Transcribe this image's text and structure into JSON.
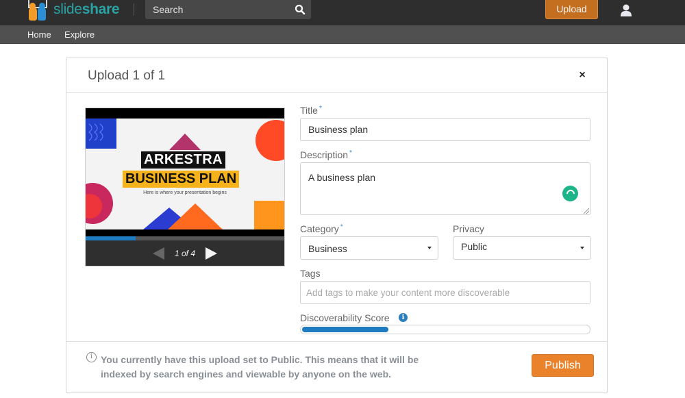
{
  "header": {
    "logo_text_light": "slide",
    "logo_text_bold": "share",
    "search_placeholder": "Search",
    "upload_label": "Upload",
    "icons": {
      "search": "search-icon",
      "user": "user-icon"
    }
  },
  "nav": {
    "items": [
      {
        "label": "Home"
      },
      {
        "label": "Explore"
      }
    ]
  },
  "modal": {
    "title": "Upload 1 of 1",
    "close_label": "×",
    "preview": {
      "slide_title_line1": "ARKESTRA",
      "slide_title_line2": "BUSINESS PLAN",
      "slide_subtitle": "Here is where your presentation begins",
      "current_page": 1,
      "total_pages": 4,
      "page_indicator": "1 of 4",
      "progress_fraction": 0.25
    },
    "form": {
      "title_label": "Title",
      "title_value": "Business plan",
      "description_label": "Description",
      "description_value": "A business plan",
      "category_label": "Category",
      "category_value": "Business",
      "privacy_label": "Privacy",
      "privacy_value": "Public",
      "tags_label": "Tags",
      "tags_placeholder": "Add tags to make your content more discoverable",
      "tags_value": "",
      "score_label": "Discoverability Score",
      "score_fraction": 0.3,
      "required_marker": "*"
    },
    "footer": {
      "notice": "You currently have this upload set to Public. This means that it will be indexed by search engines and viewable by anyone on the web.",
      "publish_label": "Publish"
    }
  },
  "colors": {
    "topbar": "#2e2e2e",
    "navbar": "#505050",
    "brand_teal": "#2aa3a5",
    "upload_orange": "#c46f1f",
    "publish_orange": "#e9822b",
    "accent_blue": "#1e7bc0",
    "spinner_green": "#1db48a"
  }
}
